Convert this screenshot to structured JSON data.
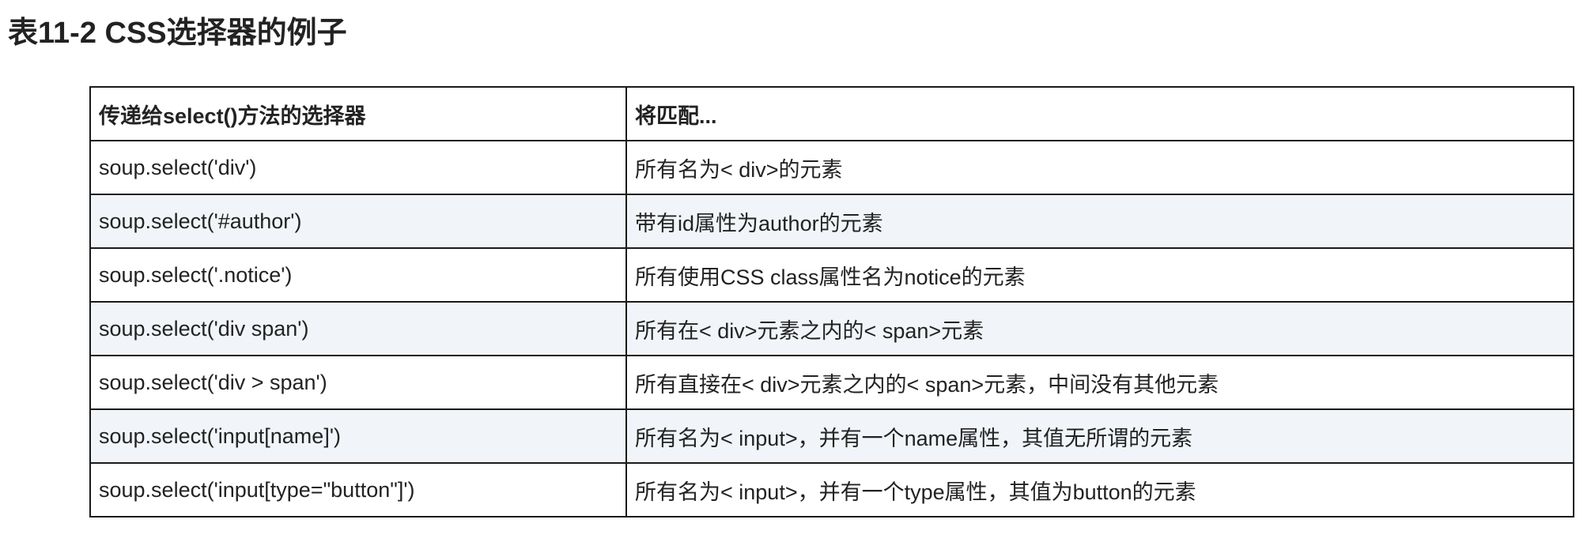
{
  "title": "表11-2 CSS选择器的例子",
  "table": {
    "headers": [
      "传递给select()方法的选择器",
      "将匹配..."
    ],
    "rows": [
      [
        "soup.select('div')",
        "所有名为< div>的元素"
      ],
      [
        "soup.select('#author')",
        "带有id属性为author的元素"
      ],
      [
        "soup.select('.notice')",
        "所有使用CSS class属性名为notice的元素"
      ],
      [
        "soup.select('div span')",
        "所有在< div>元素之内的< span>元素"
      ],
      [
        "soup.select('div > span')",
        "所有直接在< div>元素之内的< span>元素，中间没有其他元素"
      ],
      [
        "soup.select('input[name]')",
        "所有名为< input>，并有一个name属性，其值无所谓的元素"
      ],
      [
        "soup.select('input[type=\"button\"]')",
        "所有名为< input>，并有一个type属性，其值为button的元素"
      ]
    ]
  },
  "colors": {
    "row_alt_bg": "#f1f5f9",
    "border": "#1a1a1a",
    "text": "#222222"
  }
}
